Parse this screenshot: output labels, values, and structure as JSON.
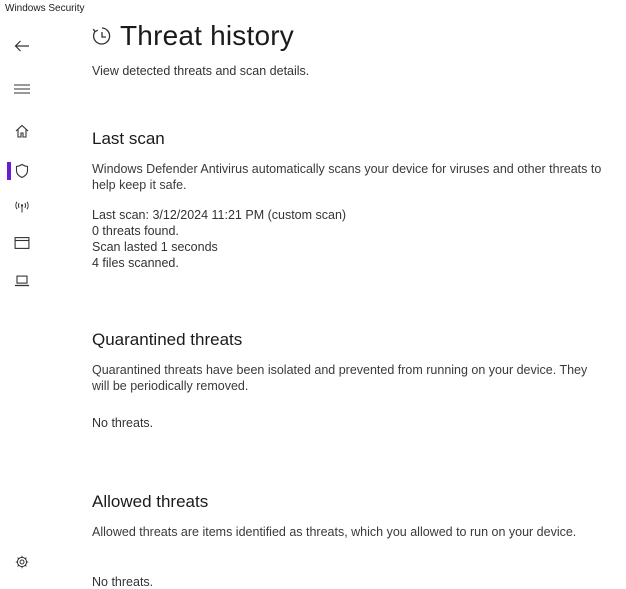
{
  "window": {
    "title": "Windows Security"
  },
  "sidebar": {
    "items": [
      {
        "icon": "back-arrow-icon"
      },
      {
        "icon": "hamburger-menu-icon"
      },
      {
        "icon": "home-icon"
      },
      {
        "icon": "shield-icon",
        "active": true
      },
      {
        "icon": "wireless-network-icon"
      },
      {
        "icon": "app-browser-icon"
      },
      {
        "icon": "laptop-icon"
      },
      {
        "icon": "gear-icon"
      }
    ],
    "accent_color": "#6a1bd8"
  },
  "page": {
    "icon": "history-clock-icon",
    "title": "Threat history",
    "description": "View detected threats and scan details."
  },
  "last_scan": {
    "title": "Last scan",
    "description": "Windows Defender Antivirus automatically scans your device for viruses and other threats to help keep it safe.",
    "lines": [
      "Last scan: 3/12/2024 11:21 PM (custom scan)",
      "0 threats found.",
      "Scan lasted 1 seconds",
      "4 files scanned."
    ]
  },
  "quarantined": {
    "title": "Quarantined threats",
    "description": "Quarantined threats have been isolated and prevented from running on your device.  They will be periodically removed.",
    "status": "No threats."
  },
  "allowed": {
    "title": "Allowed threats",
    "description": "Allowed threats are items identified as threats, which you allowed to run on your device.",
    "status": "No threats."
  }
}
